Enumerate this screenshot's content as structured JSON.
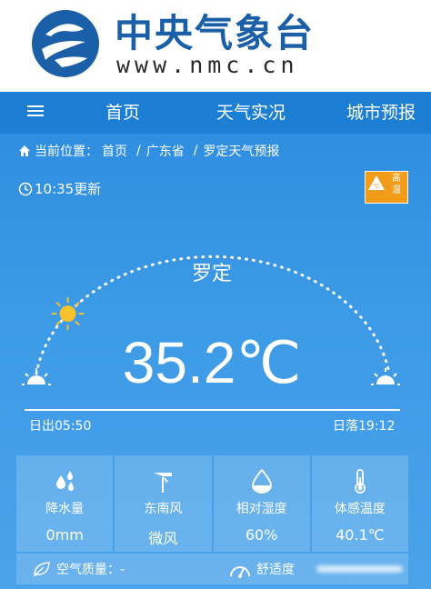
{
  "header": {
    "site_name": "中央气象台",
    "site_url": "www.nmc.cn"
  },
  "nav": {
    "items": [
      {
        "label": "首页"
      },
      {
        "label": "天气实况"
      },
      {
        "label": "城市预报"
      }
    ]
  },
  "breadcrumb": {
    "prefix": "当前位置：",
    "items": [
      "首页",
      "广东省",
      "罗定天气预报"
    ],
    "separator": "/"
  },
  "update_time": "10:35更新",
  "warning": {
    "label": "高温",
    "color": "#f39c19"
  },
  "weather": {
    "city": "罗定",
    "temperature": "35.2℃",
    "sunrise": "日出05:50",
    "sunset": "日落19:12",
    "sun_position": 0.15
  },
  "cards": [
    {
      "icon": "raindrops-icon",
      "label": "降水量",
      "value": "0mm"
    },
    {
      "icon": "windmill-icon",
      "label": "东南风",
      "value": "微风"
    },
    {
      "icon": "humidity-drop-icon",
      "label": "相对湿度",
      "value": "60%"
    },
    {
      "icon": "thermometer-icon",
      "label": "体感温度",
      "value": "40.1℃"
    }
  ],
  "bottom": {
    "air_quality": "空气质量：-",
    "comfort": "舒适度"
  },
  "colors": {
    "brand": "#1a5fa8",
    "nav": "#1c7fd4",
    "sky": "#3d9ae6"
  }
}
